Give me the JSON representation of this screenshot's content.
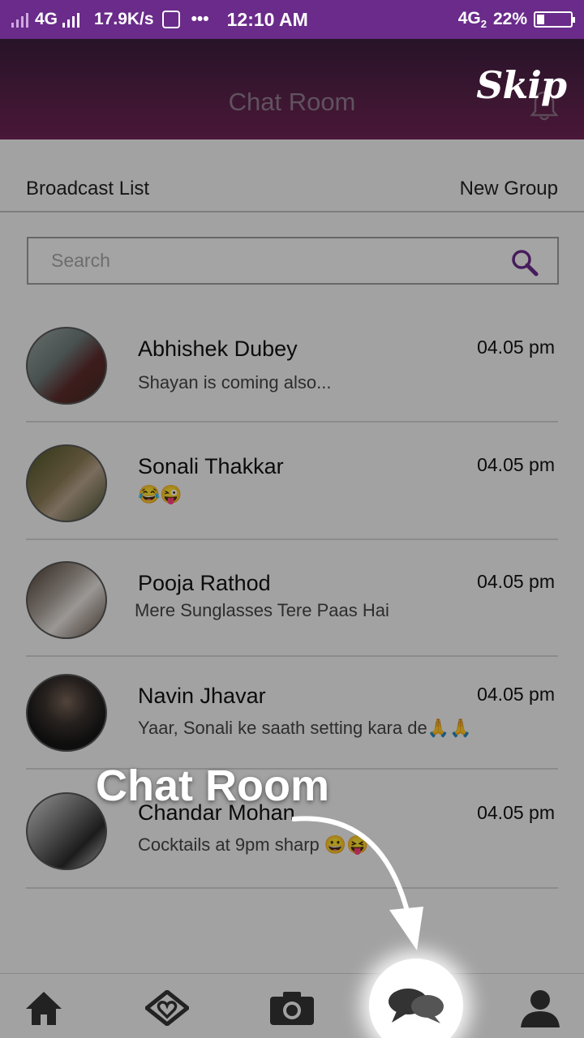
{
  "status_bar": {
    "network1": "4G",
    "speed": "17.9K/s",
    "dots": "•••",
    "time": "12:10 AM",
    "network2": "4G",
    "network2_sub": "2",
    "battery": "22%",
    "battery_level": 0.22
  },
  "header": {
    "title": "Chat Room",
    "skip_label": "Skip"
  },
  "tabs": {
    "left": "Broadcast List",
    "right": "New Group"
  },
  "search": {
    "placeholder": "Search"
  },
  "chats": [
    {
      "name": "Abhishek Dubey",
      "time": "04.05 pm",
      "message": "Shayan is coming also..."
    },
    {
      "name": "Sonali Thakkar",
      "time": "04.05 pm",
      "message": "😂😜"
    },
    {
      "name": "Pooja Rathod",
      "time": "04.05 pm",
      "message": "Mere Sunglasses Tere Paas Hai"
    },
    {
      "name": "Navin Jhavar",
      "time": "04.05 pm",
      "message": "Yaar, Sonali ke saath setting kara de🙏🙏"
    },
    {
      "name": "Chandar Mohan",
      "time": "04.05 pm",
      "message": "Cocktails at 9pm sharp 😀😝"
    }
  ],
  "coach": {
    "title": "Chat Room"
  },
  "bottom_nav": {
    "items": [
      "home-icon",
      "matches-icon",
      "camera-icon",
      "chat-icon",
      "profile-icon"
    ],
    "active": "chat-icon"
  },
  "colors": {
    "status_bar": "#6a2b8a",
    "header_top": "#3b1e3d",
    "header_bottom": "#6e2353",
    "accent": "#6a2b8a"
  }
}
